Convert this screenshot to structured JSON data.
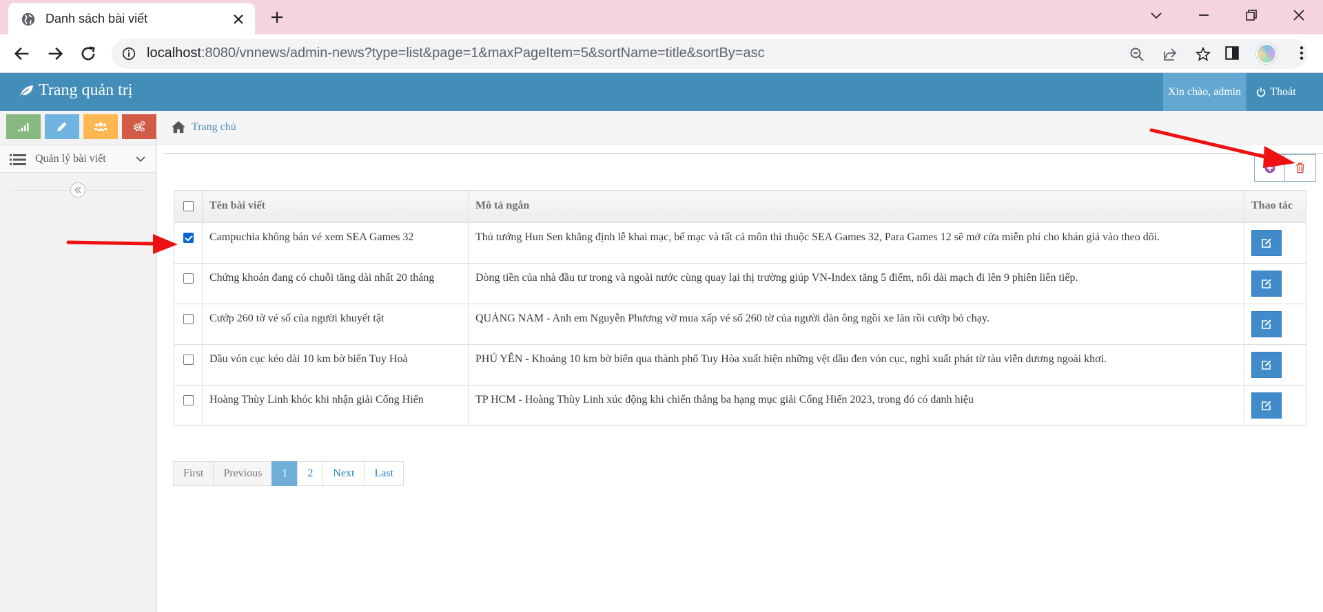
{
  "browser": {
    "tab_title": "Danh sách bài viết",
    "url_host": "localhost",
    "url_rest": ":8080/vnnews/admin-news?type=list&page=1&maxPageItem=5&sortName=title&sortBy=asc"
  },
  "navbar": {
    "brand": "Trang quản trị",
    "greeting": "Xin chào, admin",
    "logout": "Thoát",
    "color": "#438eb9"
  },
  "sidebar": {
    "shortcut_colors": [
      "#87b87f",
      "#6fb3e0",
      "#ffb752",
      "#d15b47"
    ],
    "menu_label": "Quản lý bài viết"
  },
  "breadcrumb": {
    "home": "Trang chủ"
  },
  "table": {
    "headers": {
      "title": "Tên bài viết",
      "description": "Mô tả ngắn",
      "actions": "Thao tác"
    },
    "rows": [
      {
        "checked": true,
        "title": "Campuchia không bán vé xem SEA Games 32",
        "description": "Thủ tướng Hun Sen khẳng định lễ khai mạc, bế mạc và tất cả môn thi thuộc SEA Games 32, Para Games 12 sẽ mở cửa miễn phí cho khán giả vào theo dõi."
      },
      {
        "checked": false,
        "title": "Chứng khoán đang có chuỗi tăng dài nhất 20 tháng",
        "description": "Dòng tiền của nhà đầu tư trong và ngoài nước cùng quay lại thị trường giúp VN-Index tăng 5 điểm, nối dài mạch đi lên 9 phiên liên tiếp."
      },
      {
        "checked": false,
        "title": "Cướp 260 tờ vé số của người khuyết tật",
        "description": "QUẢNG NAM - Anh em Nguyễn Phương vờ mua xấp vé số 260 tờ của người đàn ông ngồi xe lăn rồi cướp bỏ chạy."
      },
      {
        "checked": false,
        "title": "Dầu vón cục kéo dài 10 km bờ biển Tuy Hoà",
        "description": "PHÚ YÊN - Khoảng 10 km bờ biển qua thành phố Tuy Hòa xuất hiện những vệt dầu đen vón cục, nghi xuất phát từ tàu viễn dương ngoài khơi."
      },
      {
        "checked": false,
        "title": "Hoàng Thùy Linh khóc khi nhận giải Cống Hiến",
        "description": "TP HCM - Hoàng Thùy Linh xúc động khi chiến thắng ba hạng mục giải Cống Hiến 2023, trong đó có danh hiệu"
      }
    ]
  },
  "pagination": {
    "first": "First",
    "previous": "Previous",
    "pages": [
      "1",
      "2"
    ],
    "current": "1",
    "next": "Next",
    "last": "Last"
  },
  "annotation_color": "#ee1111"
}
